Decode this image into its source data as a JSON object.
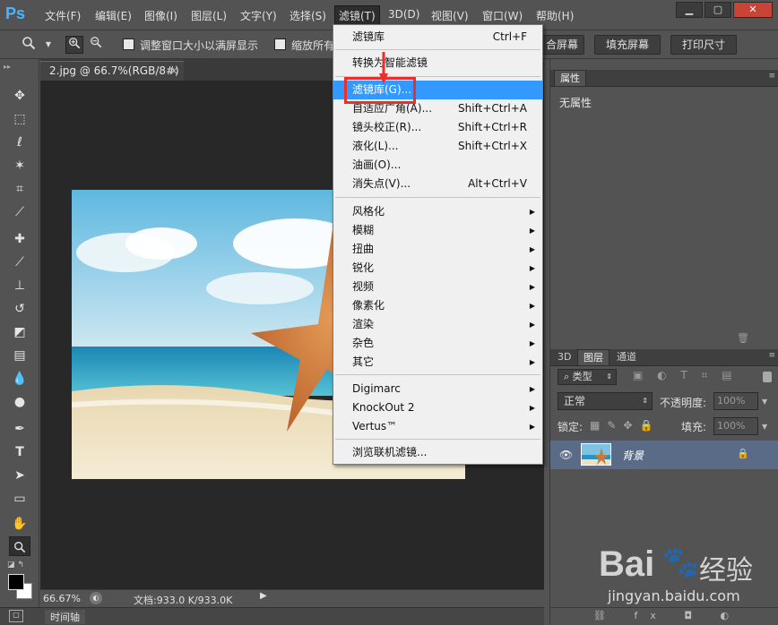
{
  "app": {
    "logo": "Ps"
  },
  "menubar": {
    "items": [
      "文件(F)",
      "编辑(E)",
      "图像(I)",
      "图层(L)",
      "文字(Y)",
      "选择(S)",
      "滤镜(T)",
      "3D(D)",
      "视图(V)",
      "窗口(W)",
      "帮助(H)"
    ],
    "active": "滤镜(T)"
  },
  "options": {
    "fit_window_label": "调整窗口大小以满屏显示",
    "zoom_all_label": "缩放所有",
    "fill_screen_partial": "合屏幕",
    "fill_screen": "填充屏幕",
    "print_size": "打印尺寸"
  },
  "document": {
    "tab_title": "2.jpg @ 66.7%(RGB/8#)",
    "zoom": "66.67%",
    "doc_info": "文档:933.0 K/933.0K",
    "timeline": "时间轴"
  },
  "filter_menu": {
    "last_filter": {
      "label": "滤镜库",
      "shortcut": "Ctrl+F"
    },
    "smart_filter": "转换为智能滤镜",
    "items_group1": [
      {
        "label": "滤镜库(G)...",
        "shortcut": ""
      },
      {
        "label": "自适应广角(A)...",
        "shortcut": "Shift+Ctrl+A"
      },
      {
        "label": "镜头校正(R)...",
        "shortcut": "Shift+Ctrl+R"
      },
      {
        "label": "液化(L)...",
        "shortcut": "Shift+Ctrl+X"
      },
      {
        "label": "油画(O)...",
        "shortcut": ""
      },
      {
        "label": "消失点(V)...",
        "shortcut": "Alt+Ctrl+V"
      }
    ],
    "submenus1": [
      "风格化",
      "模糊",
      "扭曲",
      "锐化",
      "视频",
      "像素化",
      "渲染",
      "杂色",
      "其它"
    ],
    "submenus2": [
      "Digimarc",
      "KnockOut 2",
      "Vertus™"
    ],
    "browse": "浏览联机滤镜..."
  },
  "properties_panel": {
    "tab": "属性",
    "content": "无属性"
  },
  "layers_panel": {
    "tabs": [
      "3D",
      "图层",
      "通道"
    ],
    "kind_filter": "类型",
    "blend_mode": "正常",
    "opacity_label": "不透明度:",
    "opacity_value": "100%",
    "lock_label": "锁定:",
    "fill_label": "填充:",
    "fill_value": "100%",
    "layers": [
      {
        "name": "背景"
      }
    ]
  },
  "watermark": {
    "brand": "Bai",
    "brand_cn": "经验",
    "url": "jingyan.baidu.com"
  },
  "colors": {
    "menu_highlight": "#3399ff",
    "callout": "#e8302d",
    "layer_selected": "#5a6b88"
  }
}
